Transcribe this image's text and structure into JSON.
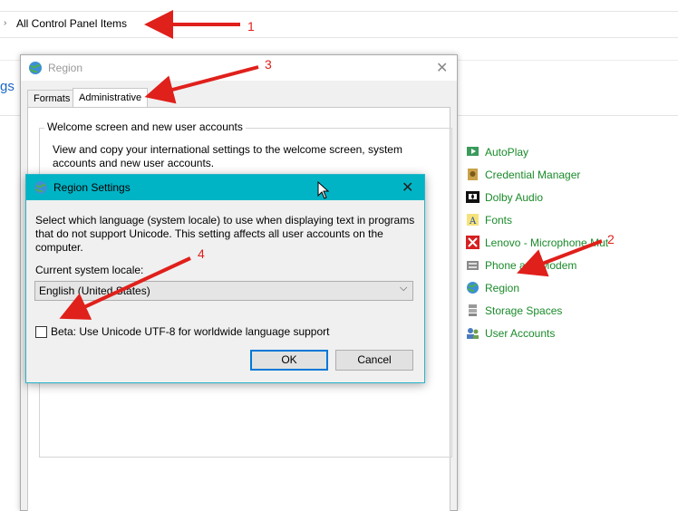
{
  "control_panel": {
    "address": "All Control Panel Items",
    "left_link_fragment": "gs",
    "items": [
      {
        "label": "AutoPlay",
        "icon": "autoplay-icon",
        "color": "#2e8b57"
      },
      {
        "label": "Credential Manager",
        "icon": "credential-manager-icon",
        "color": "#b88a2e"
      },
      {
        "label": "Dolby Audio",
        "icon": "dolby-icon",
        "color": "#000000"
      },
      {
        "label": "Fonts",
        "icon": "fonts-icon",
        "color": "#e6b800"
      },
      {
        "label": "Lenovo - Microphone Mut",
        "icon": "microphone-icon",
        "color": "#d62020"
      },
      {
        "label": "Phone and Modem",
        "icon": "phone-icon",
        "color": "#666666"
      },
      {
        "label": "Region",
        "icon": "globe-icon",
        "color": "#2f7dc2"
      },
      {
        "label": "Storage Spaces",
        "icon": "storage-icon",
        "color": "#888888"
      },
      {
        "label": "User Accounts",
        "icon": "users-icon",
        "color": "#3a6ea5"
      }
    ]
  },
  "region_window": {
    "title": "Region",
    "tabs": [
      "Formats",
      "Administrative"
    ],
    "active_tab": "Administrative",
    "group_title": "Welcome screen and new user accounts",
    "group_desc": "View and copy your international settings to the welcome screen, system accounts and new user accounts."
  },
  "region_settings": {
    "title": "Region Settings",
    "description": "Select which language (system locale) to use when displaying text in programs that do not support Unicode. This setting affects all user accounts on the computer.",
    "locale_label": "Current system locale:",
    "locale_value": "English (United States)",
    "utf8_label": "Beta: Use Unicode UTF-8 for worldwide language support",
    "utf8_checked": false,
    "ok_label": "OK",
    "cancel_label": "Cancel"
  },
  "annotations": {
    "color": "#e0201b",
    "numbers": [
      "1",
      "2",
      "3",
      "4"
    ]
  }
}
